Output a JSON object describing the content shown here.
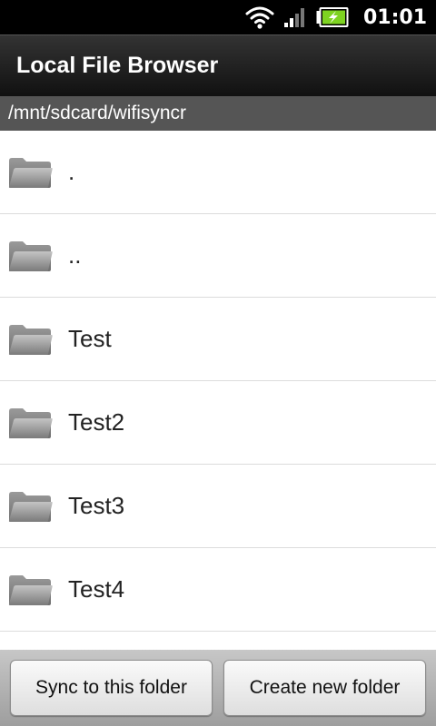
{
  "status_bar": {
    "time": "01:01",
    "icons": [
      "wifi-icon",
      "signal-icon",
      "battery-charging-icon"
    ]
  },
  "header": {
    "title": "Local File Browser"
  },
  "path": "/mnt/sdcard/wifisyncr",
  "files": [
    {
      "name": ".",
      "icon": "folder-icon"
    },
    {
      "name": "..",
      "icon": "folder-icon"
    },
    {
      "name": "Test",
      "icon": "folder-icon"
    },
    {
      "name": "Test2",
      "icon": "folder-icon"
    },
    {
      "name": "Test3",
      "icon": "folder-icon"
    },
    {
      "name": "Test4",
      "icon": "folder-icon"
    }
  ],
  "buttons": {
    "sync_label": "Sync to this folder",
    "create_label": "Create new folder"
  },
  "colors": {
    "status_bar": "#000000",
    "title_bar": "#1a1a1a",
    "path_bar": "#555555",
    "battery_fill": "#7ed321",
    "folder": "#8a8a8a"
  }
}
